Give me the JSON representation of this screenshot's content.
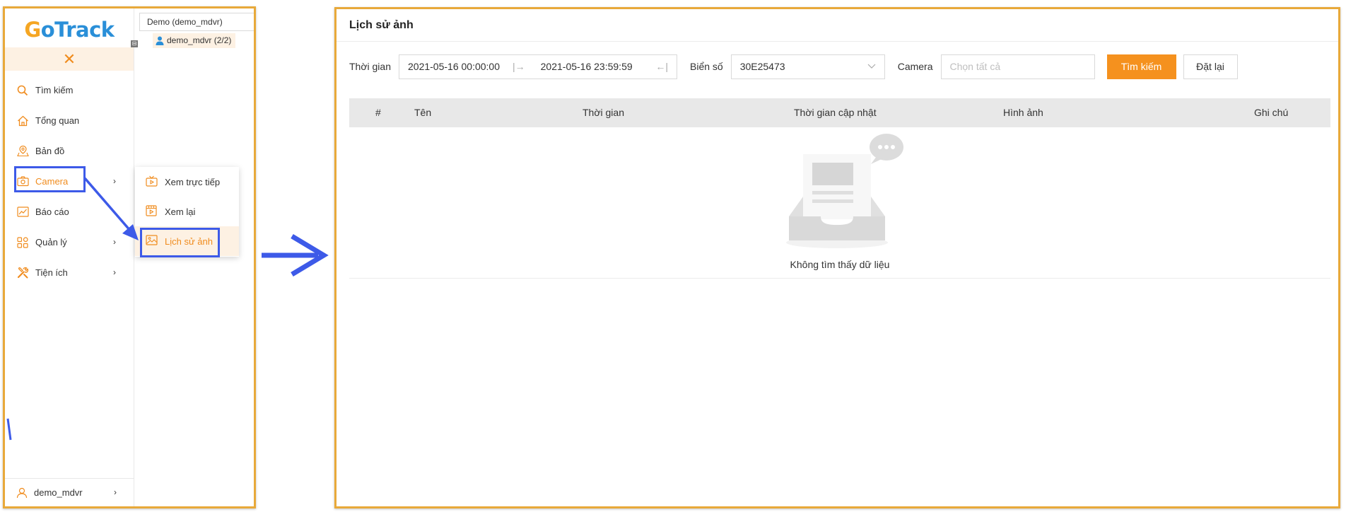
{
  "brand": {
    "logo_g": "G",
    "logo_rest": "oTrack"
  },
  "colors": {
    "accent": "#f5911e",
    "border": "#e8a93a",
    "highlight": "#3d5ae8"
  },
  "sidebar": {
    "close_symbol": "✕",
    "items": [
      {
        "label": "Tìm kiếm",
        "icon": "search-icon"
      },
      {
        "label": "Tổng quan",
        "icon": "home-icon"
      },
      {
        "label": "Bản đồ",
        "icon": "map-icon"
      },
      {
        "label": "Camera",
        "icon": "camera-icon",
        "has_children": true,
        "active": true
      },
      {
        "label": "Báo cáo",
        "icon": "chart-icon"
      },
      {
        "label": "Quản lý",
        "icon": "grid-icon",
        "has_children": true
      },
      {
        "label": "Tiện ích",
        "icon": "tools-icon",
        "has_children": true
      }
    ],
    "user": "demo_mdvr"
  },
  "tree": {
    "account": "Demo (demo_mdvr)",
    "node": "demo_mdvr (2/2)"
  },
  "camera_submenu": [
    {
      "label": "Xem trực tiếp",
      "icon": "live-tv-icon"
    },
    {
      "label": "Xem lại",
      "icon": "playback-icon"
    },
    {
      "label": "Lịch sử ảnh",
      "icon": "image-icon",
      "active": true
    }
  ],
  "page": {
    "title": "Lịch sử ảnh",
    "filters": {
      "time_label": "Thời gian",
      "time_start": "2021-05-16 00:00:00",
      "time_end": "2021-05-16 23:59:59",
      "plate_label": "Biển số",
      "plate_value": "30E25473",
      "camera_label": "Camera",
      "camera_placeholder": "Chọn tất cả",
      "search_button": "Tìm kiếm",
      "reset_button": "Đặt lại"
    },
    "table": {
      "columns": [
        "#",
        "Tên",
        "Thời gian",
        "Thời gian cập nhật",
        "Hình ảnh",
        "Ghi chú"
      ],
      "empty_text": "Không tìm thấy dữ liệu"
    }
  }
}
